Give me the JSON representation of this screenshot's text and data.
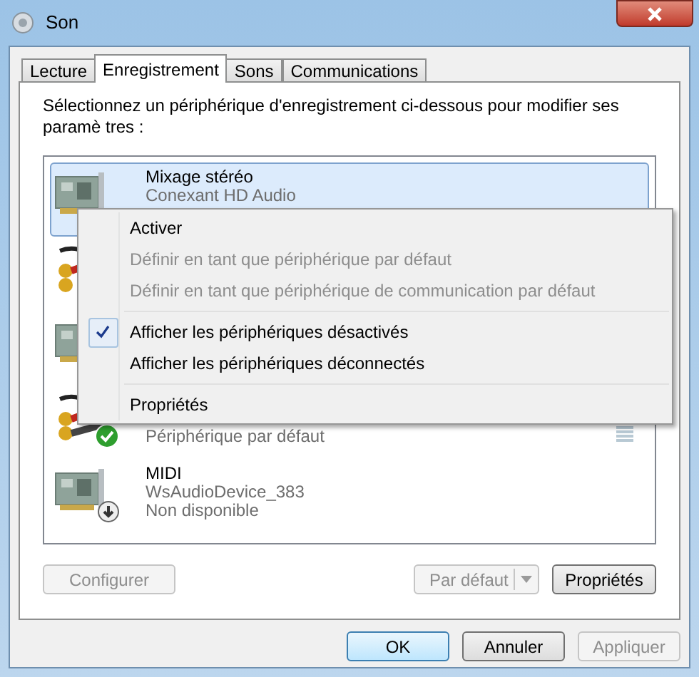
{
  "window": {
    "title": "Son"
  },
  "tabs": [
    {
      "label": "Lecture",
      "selected": false
    },
    {
      "label": "Enregistrement",
      "selected": true
    },
    {
      "label": "Sons",
      "selected": false
    },
    {
      "label": "Communications",
      "selected": false
    }
  ],
  "instruction": "Sélectionnez un périphérique d'enregistrement ci-dessous pour modifier ses paramè tres :",
  "devices": [
    {
      "kind": "card",
      "name": "Mixage stéréo",
      "driver": "Conexant HD Audio",
      "selected": true,
      "default_device": false,
      "unavailable": false
    },
    {
      "kind": "cables",
      "selected": false
    },
    {
      "kind": "card",
      "selected": false
    },
    {
      "kind": "cables",
      "status": "Périphérique par défaut",
      "selected": false,
      "default_device": true,
      "unavailable": false
    },
    {
      "kind": "card",
      "name": "MIDI",
      "driver": "WsAudioDevice_383",
      "status": "Non disponible",
      "selected": false,
      "default_device": false,
      "unavailable": true
    }
  ],
  "context_menu": [
    {
      "kind": "item",
      "label": "Activer",
      "disabled": false,
      "checked": false
    },
    {
      "kind": "item",
      "label": "Définir en tant que périphérique par défaut",
      "disabled": true,
      "checked": false
    },
    {
      "kind": "item",
      "label": "Définir en tant que périphérique de communication par défaut",
      "disabled": true,
      "checked": false
    },
    {
      "kind": "separator"
    },
    {
      "kind": "item",
      "label": "Afficher les périphériques désactivés",
      "disabled": false,
      "checked": true
    },
    {
      "kind": "item",
      "label": "Afficher les périphériques déconnectés",
      "disabled": false,
      "checked": false
    },
    {
      "kind": "separator"
    },
    {
      "kind": "item",
      "label": "Propriétés",
      "disabled": false,
      "checked": false
    }
  ],
  "list_buttons": [
    {
      "kind": "button",
      "label": "Configurer",
      "disabled": true
    },
    {
      "kind": "split",
      "label": "Par défaut",
      "disabled": true
    },
    {
      "kind": "button",
      "label": "Propriétés",
      "disabled": false
    }
  ],
  "dialog_buttons": [
    {
      "label": "OK",
      "disabled": false,
      "default": true
    },
    {
      "label": "Annuler",
      "disabled": false,
      "default": false
    },
    {
      "label": "Appliquer",
      "disabled": true,
      "default": false
    }
  ]
}
